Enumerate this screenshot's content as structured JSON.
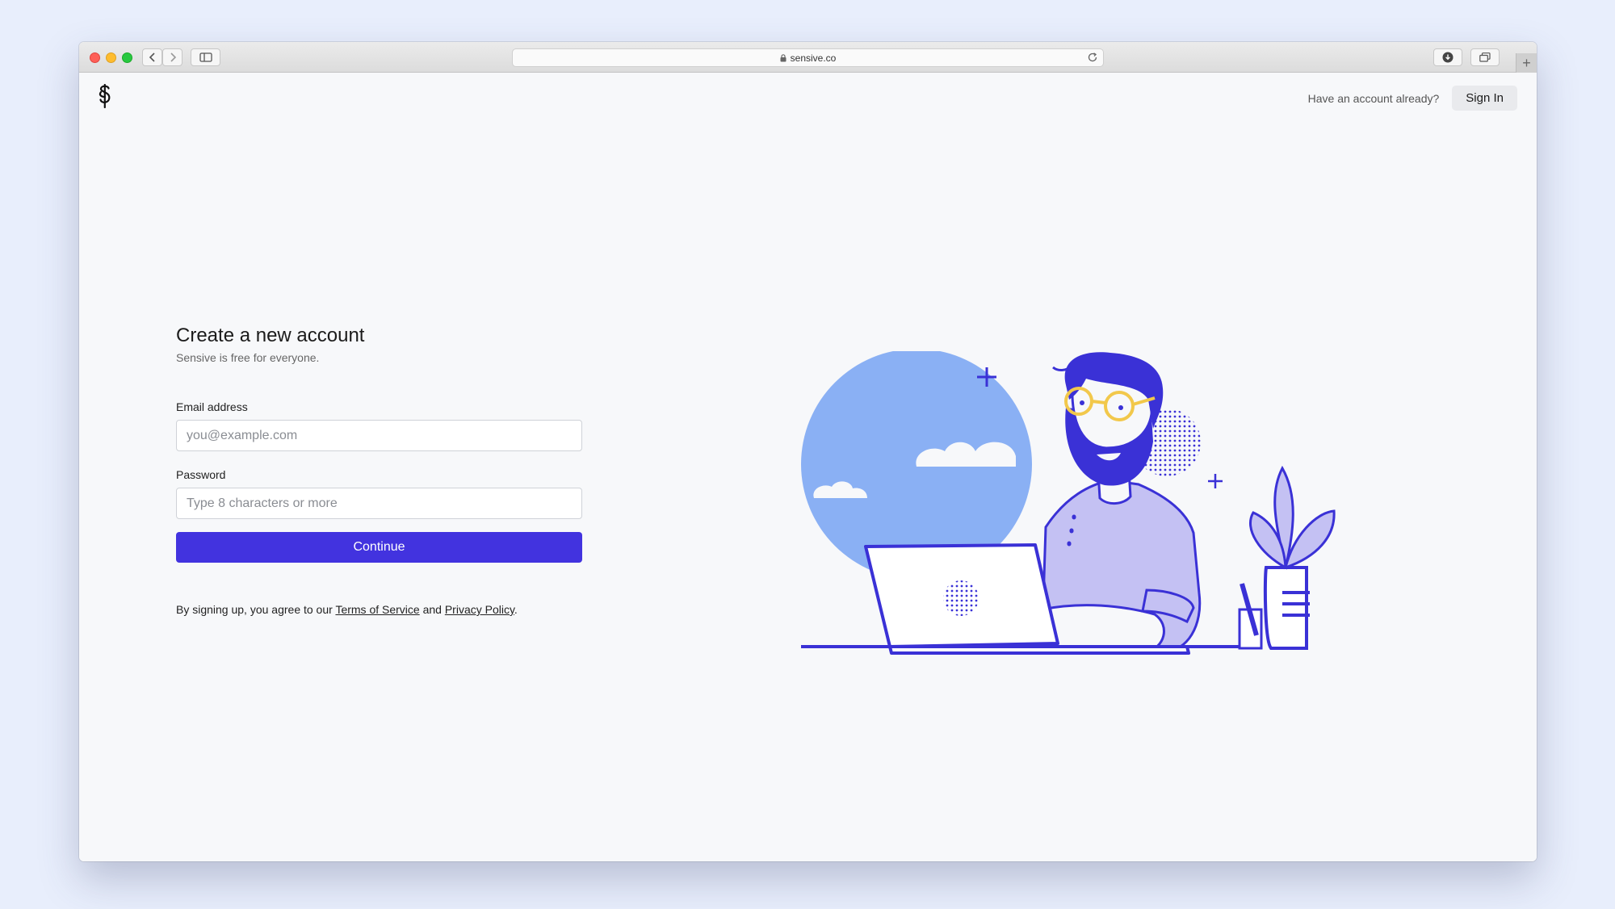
{
  "browser": {
    "url": "sensive.co"
  },
  "header": {
    "question": "Have an account already?",
    "signin_label": "Sign In"
  },
  "form": {
    "title": "Create a new account",
    "subtitle": "Sensive is free for everyone.",
    "email_label": "Email address",
    "email_placeholder": "you@example.com",
    "email_value": "",
    "password_label": "Password",
    "password_placeholder": "Type 8 characters or more",
    "password_value": "",
    "continue_label": "Continue"
  },
  "terms": {
    "prefix": "By signing up, you agree to our ",
    "terms_link": "Terms of Service",
    "middle": " and ",
    "privacy_link": "Privacy Policy",
    "suffix": "."
  },
  "colors": {
    "accent": "#4233df",
    "illustration_blue": "#3a31d6",
    "sky": "#8ab0f4"
  }
}
